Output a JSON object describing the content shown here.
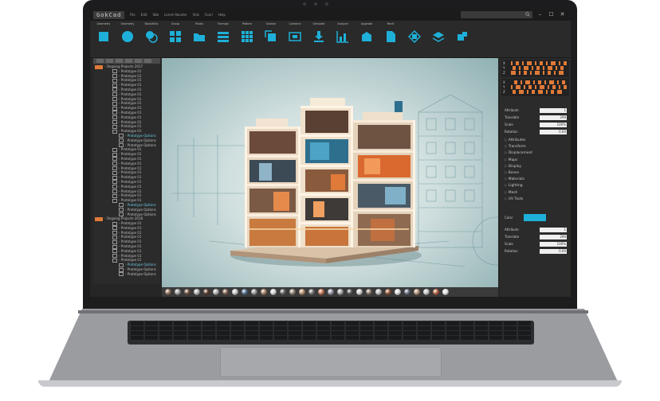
{
  "app": {
    "logo": "GokCad",
    "menu": [
      "File",
      "Edit",
      "Sbb",
      "Lorem Nunder",
      "Vids",
      "Fuori",
      "Help"
    ]
  },
  "toolbar": {
    "tools": [
      {
        "label": "Geometry",
        "icon": "square-icon"
      },
      {
        "label": "Geometry",
        "icon": "circle-icon"
      },
      {
        "label": "Boolutility",
        "icon": "boolean-icon"
      },
      {
        "label": "Group",
        "icon": "grid-icon"
      },
      {
        "label": "Radio",
        "icon": "folder-icon"
      },
      {
        "label": "Formign",
        "icon": "layers-icon"
      },
      {
        "label": "Pattern",
        "icon": "pattern-icon"
      },
      {
        "label": "Snalian",
        "icon": "snap-icon"
      },
      {
        "label": "Combine",
        "icon": "combine-icon"
      },
      {
        "label": "Simulate",
        "icon": "download-icon"
      },
      {
        "label": "Analyze",
        "icon": "chart-icon"
      },
      {
        "label": "Upgrade",
        "icon": "upgrade-icon"
      },
      {
        "label": "Revit",
        "icon": "document-icon"
      },
      {
        "label": "",
        "icon": "transform-icon"
      },
      {
        "label": "",
        "icon": "stack-icon"
      },
      {
        "label": "",
        "icon": "puzzle-icon"
      }
    ]
  },
  "left_panel": {
    "groups": [
      {
        "title": "- Ongoing Projects 2017",
        "items": [
          "- Prototype 01",
          "- Prototype 01",
          "- Prototype 01",
          "- Prototype 01",
          "- Prototype 01",
          "- Prototype 01",
          "- Prototype 01",
          "- Prototype 01",
          "- Prototype 01",
          "- Prototype 01",
          "- Prototype 01",
          "- Prototype 01",
          "- Prototype 01",
          "- Prototype 01"
        ],
        "options": [
          "- Prototype Options",
          "- Prototype Options",
          "- Prototype Options"
        ],
        "items2": [
          "- Prototype 01",
          "- Prototype 01",
          "- Prototype 01",
          "- Prototype 01",
          "- Prototype 01",
          "- Prototype 01",
          "- Prototype 01",
          "- Prototype 01",
          "- Prototype 01",
          "- Prototype 01",
          "- Prototype 01",
          "- Prototype 01"
        ],
        "options2": [
          "- Prototype Options",
          "- Prototype Options",
          "- Prototype Options"
        ]
      },
      {
        "title": "- Ongoing Projects 2018",
        "items": [
          "- Prototype 01",
          "- Prototype 01",
          "- Prototype 01",
          "- Prototype 01",
          "- Prototype 01",
          "- Prototype 01",
          "- Prototype 01",
          "- Prototype 01",
          "- Prototype 01"
        ],
        "options": [
          "- Prototype Options",
          "- Prototype Options",
          "- Prototype Options"
        ]
      }
    ]
  },
  "right_panel": {
    "coord_axes": [
      "X",
      "Y",
      "Z"
    ],
    "props_top": [
      {
        "label": "Attribute",
        "value": "1"
      },
      {
        "label": "Translate",
        "value": "299"
      },
      {
        "label": "Scale",
        "value": "100%"
      },
      {
        "label": "Rotation",
        "value": "0.00"
      }
    ],
    "sections": [
      "Attributes",
      "Transform",
      "Displacement",
      "Maps",
      "Display",
      "Bones",
      "Materials",
      "Lighting",
      "Mesh",
      "UV Tools"
    ],
    "color_label": "Color",
    "props_bottom": [
      {
        "label": "Attribute",
        "value": "1"
      },
      {
        "label": "Translate",
        "value": "299"
      },
      {
        "label": "Scale",
        "value": "100%"
      },
      {
        "label": "Rotation",
        "value": "0.00"
      }
    ]
  },
  "colors": {
    "accent": "#1eb0d8",
    "group_marker": "#e07a38",
    "panel": "#2b2b2b"
  },
  "swatches": [
    "#8a6a58",
    "#9a9a9a",
    "#6a4a3a",
    "#b0b0b0",
    "#5a3a2a",
    "#a8a8a8",
    "#7a5a48",
    "#c4c4c4",
    "#4a6a8a",
    "#909090",
    "#a07a60",
    "#d0d0d0",
    "#606060",
    "#8a8070",
    "#b08a6a",
    "#707070",
    "#c07050",
    "#9090a0",
    "#a0a0a0",
    "#505050",
    "#c8c8c8",
    "#7a6a5a",
    "#b4b4b4",
    "#8a5030",
    "#d8d8d8",
    "#606878",
    "#a88a70",
    "#c0c0c0",
    "#b05a3a",
    "#e0e0e0"
  ]
}
